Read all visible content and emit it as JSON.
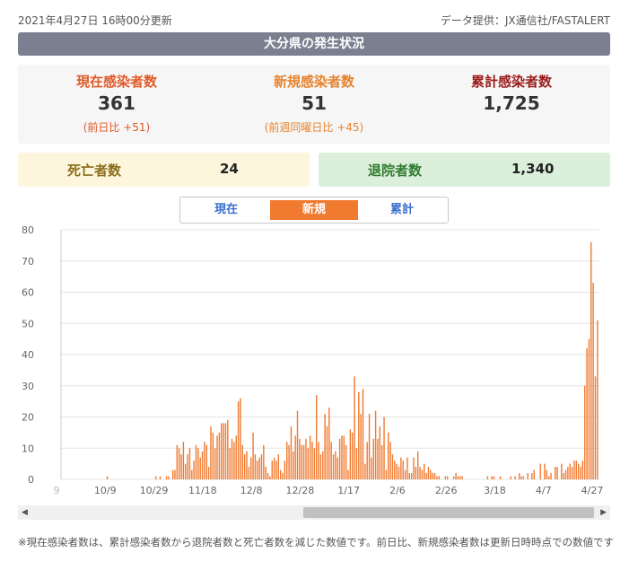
{
  "header": {
    "updated": "2021年4月27日 16時00分更新",
    "source": "データ提供：JX通信社/FASTALERT",
    "title": "大分県の発生状況"
  },
  "stats": {
    "current": {
      "label": "現在感染者数",
      "value": "361",
      "sub": "(前日比 +51)"
    },
    "new": {
      "label": "新規感染者数",
      "value": "51",
      "sub": "(前週同曜日比 +45)"
    },
    "total": {
      "label": "累計感染者数",
      "value": "1,725"
    }
  },
  "deaths": {
    "label": "死亡者数",
    "value": "24"
  },
  "recovered": {
    "label": "退院者数",
    "value": "1,340"
  },
  "tabs": [
    {
      "label": "現在",
      "active": false
    },
    {
      "label": "新規",
      "active": true
    },
    {
      "label": "累計",
      "active": false
    }
  ],
  "colors": {
    "bar": "#f07a30",
    "accent": "#f07a30",
    "title_bg": "#7a8090"
  },
  "chart_data": {
    "type": "bar",
    "series": [
      {
        "values": [
          0,
          0,
          0,
          0,
          0,
          0,
          0,
          0,
          0,
          0,
          0,
          0,
          0,
          0,
          0,
          0,
          0,
          0,
          0,
          0,
          0,
          1,
          0,
          0,
          0,
          0,
          0,
          0,
          0,
          0,
          0,
          0,
          0,
          0,
          0,
          0,
          0,
          0,
          0,
          0,
          0,
          0,
          0,
          0,
          1,
          0,
          1,
          0,
          0,
          1,
          1,
          0,
          3,
          3,
          11,
          10,
          8,
          12,
          5,
          8,
          10,
          3,
          6,
          11,
          10,
          7,
          9,
          12,
          11,
          4,
          17,
          15,
          10,
          14,
          15,
          18,
          18,
          18,
          19,
          10,
          13,
          12,
          14,
          25,
          26,
          11,
          8,
          9,
          4,
          7,
          15,
          8,
          6,
          7,
          8,
          11,
          4,
          2,
          1,
          6,
          7,
          6,
          8,
          3,
          2,
          6,
          12,
          11,
          17,
          9,
          14,
          22,
          13,
          11,
          11,
          13,
          10,
          14,
          12,
          10,
          27,
          12,
          8,
          9,
          21,
          17,
          23,
          12,
          8,
          9,
          7,
          13,
          14,
          14,
          11,
          3,
          16,
          15,
          33,
          10,
          28,
          21,
          29,
          5,
          12,
          21,
          7,
          13,
          22,
          13,
          17,
          11,
          20,
          3,
          15,
          12,
          8,
          6,
          5,
          4,
          7,
          6,
          3,
          7,
          2,
          2,
          7,
          4,
          9,
          4,
          3,
          5,
          2,
          4,
          3,
          2,
          2,
          1,
          1,
          0,
          0,
          1,
          1,
          0,
          0,
          1,
          2,
          1,
          1,
          1,
          0,
          0,
          0,
          0,
          0,
          0,
          0,
          0,
          0,
          0,
          0,
          1,
          0,
          1,
          1,
          0,
          0,
          1,
          0,
          0,
          0,
          0,
          1,
          0,
          1,
          0,
          2,
          1,
          1,
          0,
          2,
          0,
          2,
          3,
          0,
          0,
          5,
          0,
          5,
          3,
          1,
          2,
          0,
          4,
          4,
          0,
          5,
          2,
          3,
          4,
          5,
          4,
          6,
          6,
          5,
          4,
          6,
          30,
          42,
          45,
          76,
          63,
          33,
          51
        ]
      }
    ],
    "x_tick_labels": [
      "9",
      "10/9",
      "10/29",
      "11/18",
      "12/8",
      "12/28",
      "1/17",
      "2/6",
      "2/26",
      "3/18",
      "4/7",
      "4/27"
    ],
    "y_ticks": [
      0,
      10,
      20,
      30,
      40,
      50,
      60,
      70,
      80
    ],
    "ylim": [
      0,
      80
    ],
    "grid": true
  },
  "scrollbar": {
    "left_arrow": "◀",
    "right_arrow": "▶"
  },
  "note": "※現在感染者数は、累計感染者数から退院者数と死亡者数を減じた数値です。前日比、新規感染者数は更新日時時点での数値です"
}
